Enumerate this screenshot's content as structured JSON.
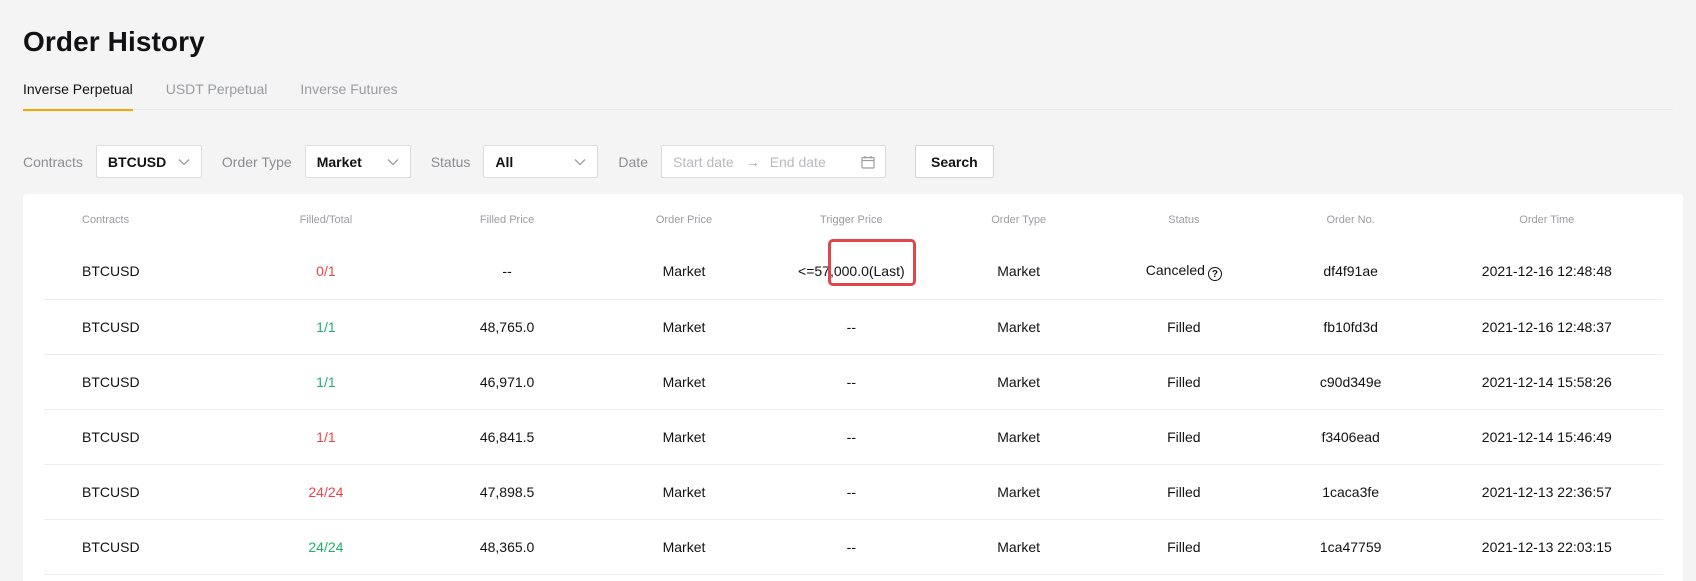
{
  "page_title": "Order History",
  "tabs": [
    {
      "label": "Inverse Perpetual",
      "active": true
    },
    {
      "label": "USDT Perpetual",
      "active": false
    },
    {
      "label": "Inverse Futures",
      "active": false
    }
  ],
  "filters": {
    "contracts_label": "Contracts",
    "contracts_value": "BTCUSD",
    "order_type_label": "Order Type",
    "order_type_value": "Market",
    "status_label": "Status",
    "status_value": "All",
    "date_label": "Date",
    "start_placeholder": "Start date",
    "end_placeholder": "End date",
    "search_label": "Search"
  },
  "table": {
    "headers": [
      "Contracts",
      "Filled/Total",
      "Filled Price",
      "Order Price",
      "Trigger Price",
      "Order Type",
      "Status",
      "Order No.",
      "Order Time"
    ],
    "rows": [
      {
        "contract": "BTCUSD",
        "filled_total": "0/1",
        "filled_color": "red",
        "filled_price": "--",
        "order_price": "Market",
        "trigger_price": "<=57,000.0(Last)",
        "order_type": "Market",
        "status": "Canceled",
        "status_help": "?",
        "order_no": "df4f91ae",
        "order_time": "2021-12-16 12:48:48"
      },
      {
        "contract": "BTCUSD",
        "filled_total": "1/1",
        "filled_color": "green",
        "filled_price": "48,765.0",
        "order_price": "Market",
        "trigger_price": "--",
        "order_type": "Market",
        "status": "Filled",
        "order_no": "fb10fd3d",
        "order_time": "2021-12-16 12:48:37"
      },
      {
        "contract": "BTCUSD",
        "filled_total": "1/1",
        "filled_color": "green",
        "filled_price": "46,971.0",
        "order_price": "Market",
        "trigger_price": "--",
        "order_type": "Market",
        "status": "Filled",
        "order_no": "c90d349e",
        "order_time": "2021-12-14 15:58:26"
      },
      {
        "contract": "BTCUSD",
        "filled_total": "1/1",
        "filled_color": "red",
        "filled_price": "46,841.5",
        "order_price": "Market",
        "trigger_price": "--",
        "order_type": "Market",
        "status": "Filled",
        "order_no": "f3406ead",
        "order_time": "2021-12-14 15:46:49"
      },
      {
        "contract": "BTCUSD",
        "filled_total": "24/24",
        "filled_color": "red",
        "filled_price": "47,898.5",
        "order_price": "Market",
        "trigger_price": "--",
        "order_type": "Market",
        "status": "Filled",
        "order_no": "1caca3fe",
        "order_time": "2021-12-13 22:36:57"
      },
      {
        "contract": "BTCUSD",
        "filled_total": "24/24",
        "filled_color": "green",
        "filled_price": "48,365.0",
        "order_price": "Market",
        "trigger_price": "--",
        "order_type": "Market",
        "status": "Filled",
        "order_no": "1ca47759",
        "order_time": "2021-12-13 22:03:15"
      }
    ]
  },
  "colors": {
    "accent": "#f7a600",
    "red": "#ef454a",
    "green": "#20b26c",
    "highlight": "#e0464a"
  },
  "icons": {
    "select_arrow": "chevron-down-icon",
    "date_arrow": "arrow-right-icon",
    "calendar": "calendar-icon",
    "help": "question-circle-icon"
  }
}
